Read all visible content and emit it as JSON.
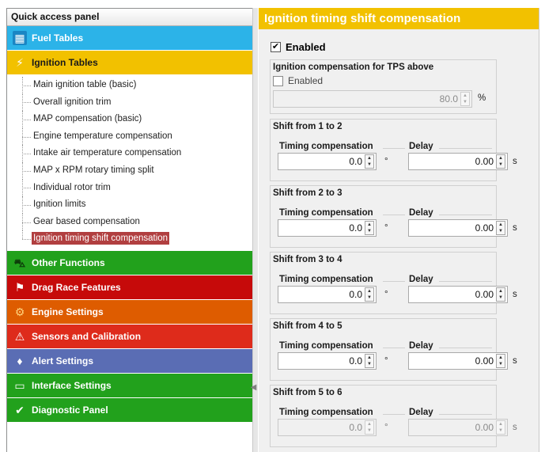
{
  "left_panel": {
    "header": "Quick access panel",
    "categories": [
      {
        "label": "Fuel Tables",
        "color": "#2cb3e8",
        "icon": "fuel-table-icon",
        "glyph": "▦"
      },
      {
        "label": "Ignition Tables",
        "color": "#f2c100",
        "icon": "ignition-spark-icon",
        "glyph": "⚡"
      },
      {
        "label": "Other Functions",
        "color": "#22a11c",
        "icon": "other-functions-icon",
        "glyph": "⛍"
      },
      {
        "label": "Drag Race Features",
        "color": "#c60a0a",
        "icon": "checkered-flag-icon",
        "glyph": "⚑"
      },
      {
        "label": "Engine Settings",
        "color": "#de5c00",
        "icon": "engine-icon",
        "glyph": "⚙"
      },
      {
        "label": "Sensors and Calibration",
        "color": "#de2b1b",
        "icon": "sensor-icon",
        "glyph": "⚠"
      },
      {
        "label": "Alert Settings",
        "color": "#5a6db4",
        "icon": "alert-bell-icon",
        "glyph": "♦"
      },
      {
        "label": "Interface Settings",
        "color": "#22a11c",
        "icon": "monitor-icon",
        "glyph": "▭"
      },
      {
        "label": "Diagnostic Panel",
        "color": "#22a11c",
        "icon": "diagnostic-check-icon",
        "glyph": "✔"
      }
    ],
    "ignition_items": [
      "Main ignition table (basic)",
      "Overall ignition trim",
      "MAP compensation (basic)",
      "Engine temperature compensation",
      "Intake air temperature compensation",
      "MAP x RPM rotary timing split",
      "Individual rotor trim",
      "Ignition limits",
      "Gear based compensation",
      "Ignition timing shift compensation"
    ],
    "selected_item": "Ignition timing shift compensation"
  },
  "right_panel": {
    "title": "Ignition timing shift compensation",
    "enabled_label": "Enabled",
    "enabled_checked": true,
    "tps_group": {
      "title": "Ignition compensation for TPS above",
      "enabled_label": "Enabled",
      "enabled_checked": false,
      "value": "80.0",
      "unit": "%"
    },
    "shifts": [
      {
        "title": "Shift from 1 to 2",
        "timing_label": "Timing compensation",
        "timing_value": "0.0",
        "timing_unit": "°",
        "delay_label": "Delay",
        "delay_value": "0.00",
        "delay_unit": "s",
        "disabled": false
      },
      {
        "title": "Shift from 2 to 3",
        "timing_label": "Timing compensation",
        "timing_value": "0.0",
        "timing_unit": "°",
        "delay_label": "Delay",
        "delay_value": "0.00",
        "delay_unit": "s",
        "disabled": false
      },
      {
        "title": "Shift from 3 to 4",
        "timing_label": "Timing compensation",
        "timing_value": "0.0",
        "timing_unit": "°",
        "delay_label": "Delay",
        "delay_value": "0.00",
        "delay_unit": "s",
        "disabled": false
      },
      {
        "title": "Shift from 4 to 5",
        "timing_label": "Timing compensation",
        "timing_value": "0.0",
        "timing_unit": "°",
        "delay_label": "Delay",
        "delay_value": "0.00",
        "delay_unit": "s",
        "disabled": false
      },
      {
        "title": "Shift from 5 to 6",
        "timing_label": "Timing compensation",
        "timing_value": "0.0",
        "timing_unit": "°",
        "delay_label": "Delay",
        "delay_value": "0.00",
        "delay_unit": "s",
        "disabled": true
      }
    ]
  }
}
